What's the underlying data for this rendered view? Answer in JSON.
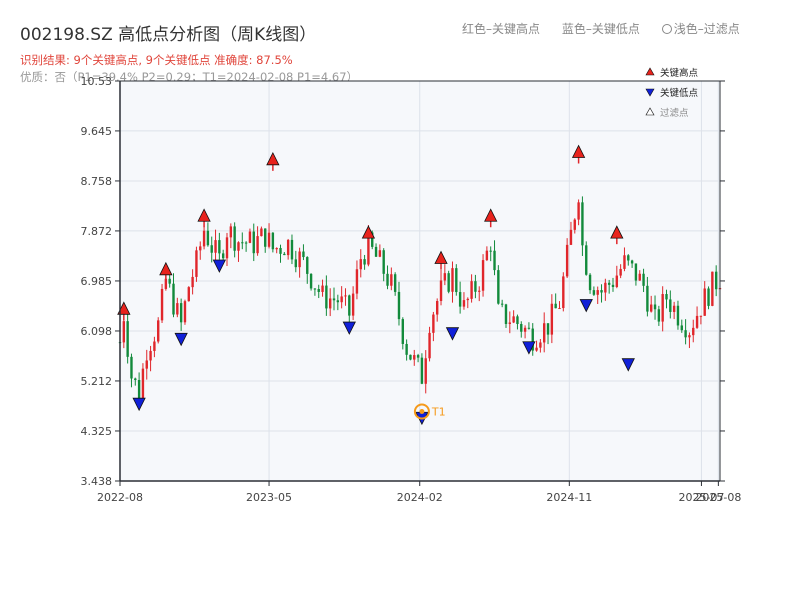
{
  "header": {
    "title": "002198.SZ 高低点分析图（周K线图）",
    "legend_red": "红色–关键高点",
    "legend_blue": "蓝色–关键低点",
    "legend_light": "浅色–过滤点",
    "result_text": "识别结果: 9个关键高点, 9个关键低点  准确度: 87.5%",
    "quality_text": "优质：否（P1=39.4%  P2=0.29；T1=2024-02-08 P1=4.67）"
  },
  "colors": {
    "up": "#e0262b",
    "down": "#128a3b",
    "high_marker": "#e8231d",
    "low_marker": "#1020d8",
    "t1": "#f59a1b",
    "plot_bg": "#f6f8fb",
    "grid": "#dde2ea"
  },
  "chart_data": {
    "type": "candlestick",
    "title": "002198.SZ 高低点分析图（周K线图）",
    "ylim": [
      3.438,
      10.53
    ],
    "yticks": [
      3.438,
      4.325,
      5.212,
      6.098,
      6.985,
      7.872,
      8.758,
      9.645,
      10.53
    ],
    "ytick_labels": [
      "3.438",
      "4.325",
      "5.212",
      "6.098",
      "6.985",
      "7.872",
      "8.758",
      "9.645",
      "10.53"
    ],
    "xlim": [
      "2022-08-01",
      "2025-08-04"
    ],
    "xticks": [
      "2022-08-01",
      "2023-05-01",
      "2024-02-01",
      "2024-11-01",
      "2025-07-01",
      "2025-08-01"
    ],
    "xtick_labels": [
      "2022-08",
      "2023-05",
      "2024-02",
      "2024-11",
      "2025-07",
      "2025-08"
    ],
    "grid": true,
    "legend_position": "top-right",
    "legend": [
      "关键高点",
      "关键低点",
      "过滤点"
    ],
    "anchors": [
      [
        "2022-08-01",
        5.9
      ],
      [
        "2022-08-08",
        6.4
      ],
      [
        "2022-08-22",
        5.3
      ],
      [
        "2022-09-05",
        5.0
      ],
      [
        "2022-09-19",
        5.8
      ],
      [
        "2022-10-10",
        6.2
      ],
      [
        "2022-10-24",
        7.0
      ],
      [
        "2022-11-07",
        6.6
      ],
      [
        "2022-11-21",
        6.2
      ],
      [
        "2022-12-05",
        6.9
      ],
      [
        "2022-12-19",
        7.3
      ],
      [
        "2023-01-02",
        7.9
      ],
      [
        "2023-01-16",
        7.6
      ],
      [
        "2023-01-30",
        7.35
      ],
      [
        "2023-02-13",
        7.9
      ],
      [
        "2023-03-06",
        7.7
      ],
      [
        "2023-04-03",
        7.65
      ],
      [
        "2023-04-24",
        7.8
      ],
      [
        "2023-05-08",
        7.55
      ],
      [
        "2023-06-05",
        7.65
      ],
      [
        "2023-07-03",
        7.3
      ],
      [
        "2023-08-07",
        6.7
      ],
      [
        "2023-09-04",
        6.65
      ],
      [
        "2023-09-25",
        6.4
      ],
      [
        "2023-10-16",
        7.4
      ],
      [
        "2023-10-30",
        7.6
      ],
      [
        "2023-11-20",
        7.3
      ],
      [
        "2023-12-11",
        6.9
      ],
      [
        "2024-01-08",
        5.8
      ],
      [
        "2024-02-05",
        5.3
      ],
      [
        "2024-02-19",
        6.3
      ],
      [
        "2024-03-11",
        6.8
      ],
      [
        "2024-04-01",
        7.1
      ],
      [
        "2024-04-22",
        6.5
      ],
      [
        "2024-05-20",
        7.0
      ],
      [
        "2024-06-10",
        7.7
      ],
      [
        "2024-06-24",
        6.4
      ],
      [
        "2024-07-22",
        6.3
      ],
      [
        "2024-08-26",
        6.0
      ],
      [
        "2024-09-23",
        6.2
      ],
      [
        "2024-10-14",
        6.6
      ],
      [
        "2024-10-28",
        7.4
      ],
      [
        "2024-11-18",
        8.6
      ],
      [
        "2024-11-25",
        7.6
      ],
      [
        "2024-12-09",
        7.0
      ],
      [
        "2024-12-30",
        6.8
      ],
      [
        "2025-01-20",
        7.0
      ],
      [
        "2025-02-10",
        7.3
      ],
      [
        "2025-03-03",
        7.1
      ],
      [
        "2025-03-17",
        6.9
      ],
      [
        "2025-04-07",
        6.25
      ],
      [
        "2025-04-28",
        6.7
      ],
      [
        "2025-05-19",
        6.4
      ],
      [
        "2025-06-09",
        6.15
      ],
      [
        "2025-06-30",
        6.55
      ],
      [
        "2025-07-21",
        6.9
      ],
      [
        "2025-08-04",
        7.05
      ]
    ],
    "wick": 0.2,
    "key_highs": [
      {
        "date": "2022-08-08",
        "value": 6.5
      },
      {
        "date": "2022-10-24",
        "value": 7.2
      },
      {
        "date": "2023-01-02",
        "value": 8.15
      },
      {
        "date": "2023-05-08",
        "value": 9.15
      },
      {
        "date": "2023-10-30",
        "value": 7.85
      },
      {
        "date": "2024-03-11",
        "value": 7.4
      },
      {
        "date": "2024-06-10",
        "value": 8.15
      },
      {
        "date": "2024-11-18",
        "value": 9.28
      },
      {
        "date": "2025-01-27",
        "value": 7.85
      }
    ],
    "key_lows": [
      {
        "date": "2022-09-05",
        "value": 4.8
      },
      {
        "date": "2022-11-21",
        "value": 5.95
      },
      {
        "date": "2023-01-30",
        "value": 7.25
      },
      {
        "date": "2023-09-25",
        "value": 6.15
      },
      {
        "date": "2024-02-05",
        "value": 4.55
      },
      {
        "date": "2024-04-01",
        "value": 6.05
      },
      {
        "date": "2024-08-19",
        "value": 5.8
      },
      {
        "date": "2024-12-02",
        "value": 6.55
      },
      {
        "date": "2025-02-17",
        "value": 5.5
      }
    ],
    "t1": {
      "date": "2024-02-05",
      "value": 4.67,
      "label": "T1"
    }
  }
}
